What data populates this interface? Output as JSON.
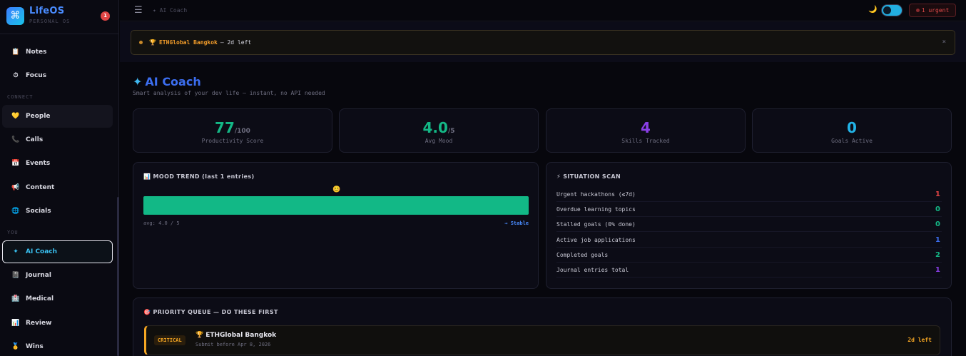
{
  "brand": {
    "name": "LifeOS",
    "subtitle": "PERSONAL OS",
    "logo_icon": "⌘",
    "notifications": "1"
  },
  "sidebar": {
    "items": [
      {
        "label": "Notes",
        "icon": "📋"
      },
      {
        "label": "Focus",
        "icon": "⏱"
      },
      {
        "label": "People",
        "icon": "💛"
      },
      {
        "label": "Calls",
        "icon": "📞"
      },
      {
        "label": "Events",
        "icon": "📅"
      },
      {
        "label": "Content",
        "icon": "📢"
      },
      {
        "label": "Socials",
        "icon": "🌐"
      },
      {
        "label": "AI Coach",
        "icon": "✦"
      },
      {
        "label": "Journal",
        "icon": "📓"
      },
      {
        "label": "Medical",
        "icon": "🏥"
      },
      {
        "label": "Review",
        "icon": "📊"
      },
      {
        "label": "Wins",
        "icon": "🥇"
      }
    ],
    "sections": {
      "connect": "CONNECT",
      "you": "YOU"
    }
  },
  "topbar": {
    "menu_icon": "☰",
    "breadcrumb": "✦ AI Coach",
    "theme_icon": "🌙",
    "urgent": "1 urgent"
  },
  "banner": {
    "icon": "🏆",
    "title": "ETHGlobal Bangkok",
    "text": "— 2d left",
    "close": "×"
  },
  "page": {
    "icon": "✦",
    "title": "AI Coach",
    "subtitle": "Smart analysis of your dev life — instant, no API needed"
  },
  "stats": [
    {
      "value": "77",
      "unit": "/100",
      "label": "Productivity Score",
      "color": "#14b886"
    },
    {
      "value": "4.0",
      "unit": "/5",
      "label": "Avg Mood",
      "color": "#14b886"
    },
    {
      "value": "4",
      "unit": "",
      "label": "Skills Tracked",
      "color": "#8b3fe8"
    },
    {
      "value": "0",
      "unit": "",
      "label": "Goals Active",
      "color": "#22b4e8"
    }
  ],
  "mood": {
    "title": "📊 MOOD TREND (last 1 entries)",
    "emoji": "😊",
    "avg": "avg: 4.0 / 5",
    "trend": "→ Stable",
    "value": 4.0,
    "max": 5
  },
  "scan": {
    "title": "⚡ SITUATION SCAN",
    "rows": [
      {
        "label": "Urgent hackathons (≤7d)",
        "value": "1",
        "color": "#e24545"
      },
      {
        "label": "Overdue learning topics",
        "value": "0",
        "color": "#14b886"
      },
      {
        "label": "Stalled goals (0% done)",
        "value": "0",
        "color": "#14b886"
      },
      {
        "label": "Active job applications",
        "value": "1",
        "color": "#3c6ef0"
      },
      {
        "label": "Completed goals",
        "value": "2",
        "color": "#14b886"
      },
      {
        "label": "Journal entries total",
        "value": "1",
        "color": "#8b3fe8"
      }
    ]
  },
  "queue": {
    "title": "🎯 PRIORITY QUEUE — DO THESE FIRST",
    "items": [
      {
        "tag": "CRITICAL",
        "icon": "🏆",
        "title": "ETHGlobal Bangkok",
        "sub": "Submit before Apr 8, 2026",
        "left": "2d left"
      }
    ]
  }
}
